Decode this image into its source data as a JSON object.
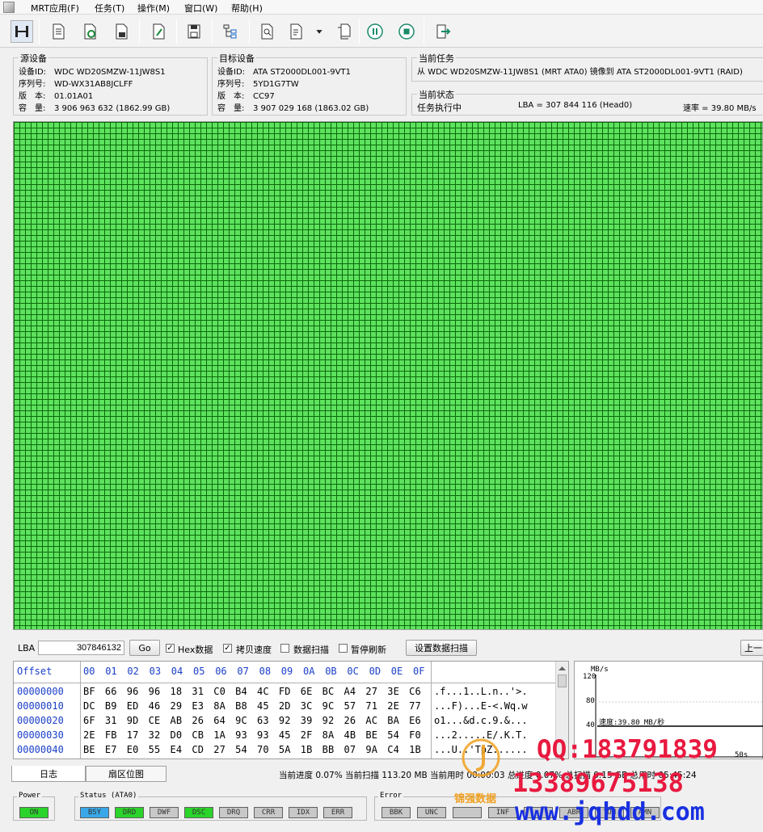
{
  "menu": [
    "MRT应用(F)",
    "任务(T)",
    "操作(M)",
    "窗口(W)",
    "帮助(H)"
  ],
  "source": {
    "title": "源设备",
    "rows": [
      {
        "label": "设备ID:",
        "value": "WDC WD20SMZW-11JW8S1"
      },
      {
        "label": "序列号:",
        "value": "WD-WX31AB8JCLFF"
      },
      {
        "label": "版　本:",
        "value": "01.01A01"
      },
      {
        "label": "容　量:",
        "value": "3 906 963 632 (1862.99 GB)"
      }
    ]
  },
  "target": {
    "title": "目标设备",
    "rows": [
      {
        "label": "设备ID:",
        "value": "ATA ST2000DL001-9VT1"
      },
      {
        "label": "序列号:",
        "value": "5YD1G7TW"
      },
      {
        "label": "版　本:",
        "value": "CC97"
      },
      {
        "label": "容　量:",
        "value": "3 907 029 168 (1863.02 GB)"
      }
    ]
  },
  "task": {
    "title": "当前任务",
    "text": "从 WDC WD20SMZW-11JW8S1 (MRT ATA0) 镜像到 ATA ST2000DL001-9VT1 (RAID)"
  },
  "state": {
    "title": "当前状态",
    "status": "任务执行中",
    "lba": "LBA = 307 844 116 (Head0)",
    "speed": "速率 = 39.80 MB/s"
  },
  "lbabar": {
    "label": "LBA",
    "value": "307846132",
    "go": "Go",
    "hex_label": "Hex数据",
    "copy_speed_label": "拷贝速度",
    "data_scan_label": "数据扫描",
    "pause_refresh_label": "暂停刷新",
    "set_scan_button": "设置数据扫描",
    "prev_button": "上一"
  },
  "hex": {
    "offset_header": "Offset",
    "columns": [
      "00",
      "01",
      "02",
      "03",
      "04",
      "05",
      "06",
      "07",
      "08",
      "09",
      "0A",
      "0B",
      "0C",
      "0D",
      "0E",
      "0F"
    ],
    "rows": [
      {
        "offset": "00000000",
        "bytes": "BF 66 96 96 18 31 C0 B4 4C FD 6E BC A4 27 3E C6",
        "ascii": ".f...1..L.n..'>."
      },
      {
        "offset": "00000010",
        "bytes": "DC B9 ED 46 29 E3 8A B8 45 2D 3C 9C 57 71 2E 77",
        "ascii": "...F)...E-<.Wq.w"
      },
      {
        "offset": "00000020",
        "bytes": "6F 31 9D CE AB 26 64 9C 63 92 39 92 26 AC BA E6",
        "ascii": "o1...&d.c.9.&..."
      },
      {
        "offset": "00000030",
        "bytes": "2E FB 17 32 D0 CB 1A 93 93 45 2F 8A 4B BE 54 F0",
        "ascii": "...2.....E/.K.T."
      },
      {
        "offset": "00000040",
        "bytes": "BE E7 E0 55 E4 CD 27 54 70 5A 1B BB 07 9A C4 1B",
        "ascii": "...U..'TpZ......"
      }
    ]
  },
  "graph": {
    "unit": "MB/s",
    "yticks": [
      "120",
      "80",
      "40"
    ],
    "speed_label": "速度:39.80 MB/秒",
    "xtick": "50s"
  },
  "tabs": [
    "日志",
    "扇区位图"
  ],
  "statusline": "当前进度 0.07% 当前扫描 113.20 MB 当前用时 00:00:03 总进度 0.07% 总扫描 0.15 GB 总用时 05:45:24",
  "power": {
    "title": "Power",
    "leds": [
      {
        "label": "ON",
        "color": "#2bd42b"
      }
    ]
  },
  "status": {
    "title": "Status (ATA0)",
    "leds": [
      {
        "label": "BSY",
        "color": "#3aa8e8"
      },
      {
        "label": "DRD",
        "color": "#2bd42b"
      },
      {
        "label": "DWF",
        "color": "#c8c8c8"
      },
      {
        "label": "DSC",
        "color": "#2bd42b"
      },
      {
        "label": "DRQ",
        "color": "#c8c8c8"
      },
      {
        "label": "CRR",
        "color": "#c8c8c8"
      },
      {
        "label": "IDX",
        "color": "#c8c8c8"
      },
      {
        "label": "ERR",
        "color": "#c8c8c8"
      }
    ]
  },
  "error": {
    "title": "Error",
    "leds": [
      {
        "label": "BBK",
        "color": "#c8c8c8"
      },
      {
        "label": "UNC",
        "color": "#c8c8c8"
      },
      {
        "label": "",
        "color": "#c8c8c8"
      },
      {
        "label": "INF",
        "color": "#c8c8c8"
      },
      {
        "label": "",
        "color": "#c8c8c8"
      },
      {
        "label": "ABR",
        "color": "#c8c8c8"
      },
      {
        "label": "TON",
        "color": "#c8c8c8"
      },
      {
        "label": "AMN",
        "color": "#c8c8c8"
      }
    ]
  },
  "watermark": {
    "qq": "QQ:183791839",
    "phone": "13389675138",
    "url": "www.jqhdd.com",
    "brand": "锦强数据"
  }
}
